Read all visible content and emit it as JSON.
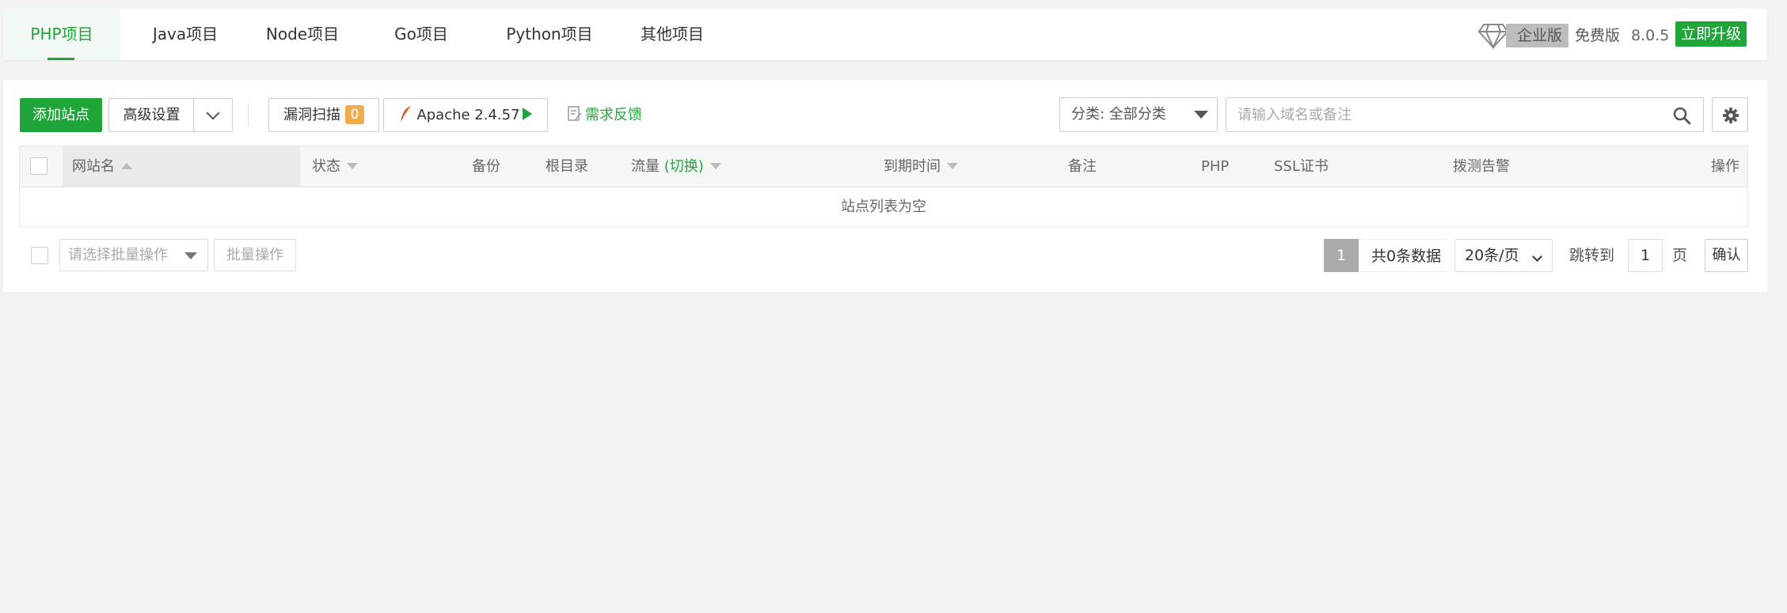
{
  "tabs": [
    {
      "label": "PHP项目",
      "active": true
    },
    {
      "label": "Java项目"
    },
    {
      "label": "Node项目"
    },
    {
      "label": "Go项目"
    },
    {
      "label": "Python项目"
    },
    {
      "label": "其他项目"
    }
  ],
  "header": {
    "edition": "企业版",
    "free": "免费版",
    "version": "8.0.5",
    "upgrade": "立即升级"
  },
  "toolbar": {
    "add_site": "添加站点",
    "advanced": "高级设置",
    "vuln_scan": "漏洞扫描",
    "vuln_count": "0",
    "apache": "Apache 2.4.57",
    "feedback": "需求反馈",
    "category": "分类: 全部分类",
    "search_placeholder": "请输入域名或备注"
  },
  "table": {
    "columns": {
      "name": "网站名",
      "status": "状态",
      "backup": "备份",
      "root": "根目录",
      "traffic": "流量",
      "traffic_switch": "(切换)",
      "expire": "到期时间",
      "remark": "备注",
      "php": "PHP",
      "ssl": "SSL证书",
      "probe": "拨测告警",
      "action": "操作"
    },
    "empty": "站点列表为空"
  },
  "footer": {
    "batch_placeholder": "请选择批量操作",
    "batch_button": "批量操作",
    "page": "1",
    "total": "共0条数据",
    "per_page": "20条/页",
    "jump_to": "跳转到",
    "jump_value": "1",
    "page_unit": "页",
    "confirm": "确认"
  },
  "colors": {
    "accent": "#20a53a",
    "badge": "#f0ad4e"
  }
}
